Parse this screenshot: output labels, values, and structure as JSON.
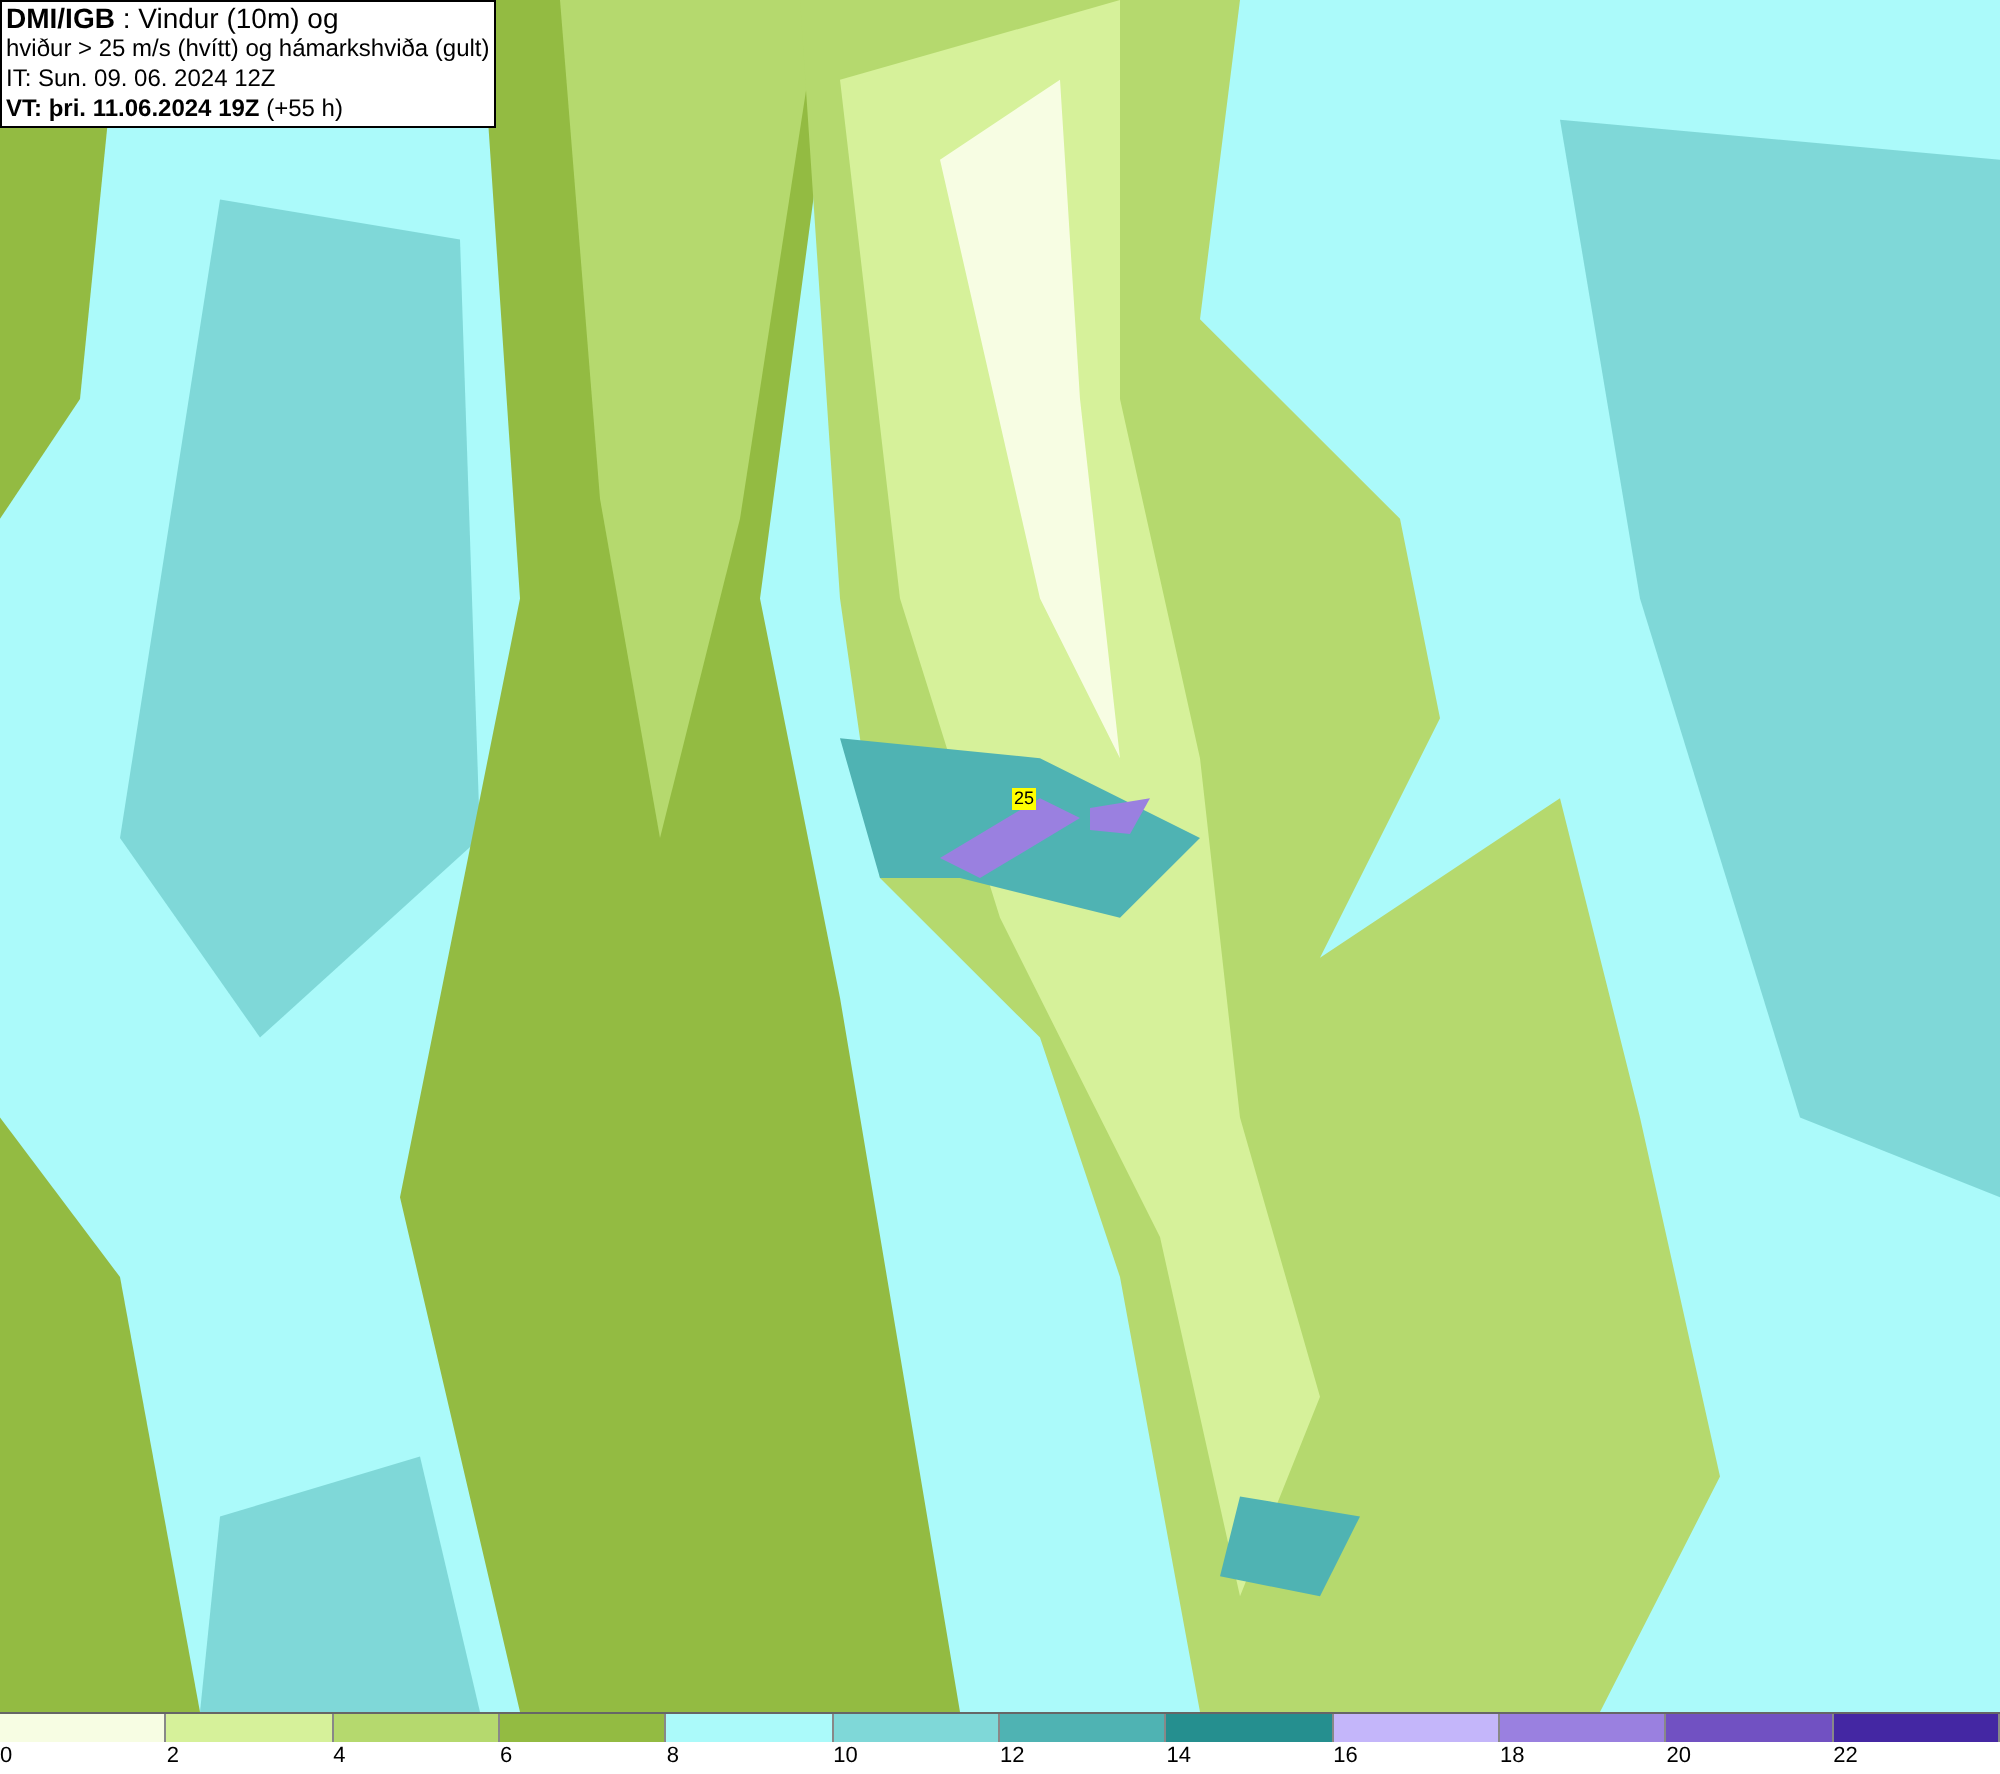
{
  "header": {
    "lines": [
      "**DMI/IGB** : Vindur (10m) og",
      "hviður > 25 m/s (hvítt) og hámarkshviða (gult)",
      "IT: Sun. 09. 06. 2024 12Z",
      "**VT: þri. 11.06.2024 19Z** (+55 h)"
    ]
  },
  "map": {
    "marker": "25"
  },
  "legend": [
    {
      "label": "0",
      "color": "#f7fde3"
    },
    {
      "label": "2",
      "color": "#d6f19a"
    },
    {
      "label": "4",
      "color": "#b5d96e"
    },
    {
      "label": "6",
      "color": "#93bb42"
    },
    {
      "label": "8",
      "color": "#abfafa"
    },
    {
      "label": "10",
      "color": "#7fd8d8"
    },
    {
      "label": "12",
      "color": "#4fb3b3"
    },
    {
      "label": "14",
      "color": "#258f8f"
    },
    {
      "label": "16",
      "color": "#c4b6fa"
    },
    {
      "label": "18",
      "color": "#9a80e0"
    },
    {
      "label": "20",
      "color": "#7151c2"
    },
    {
      "label": "22",
      "color": "#4427a3"
    }
  ]
}
